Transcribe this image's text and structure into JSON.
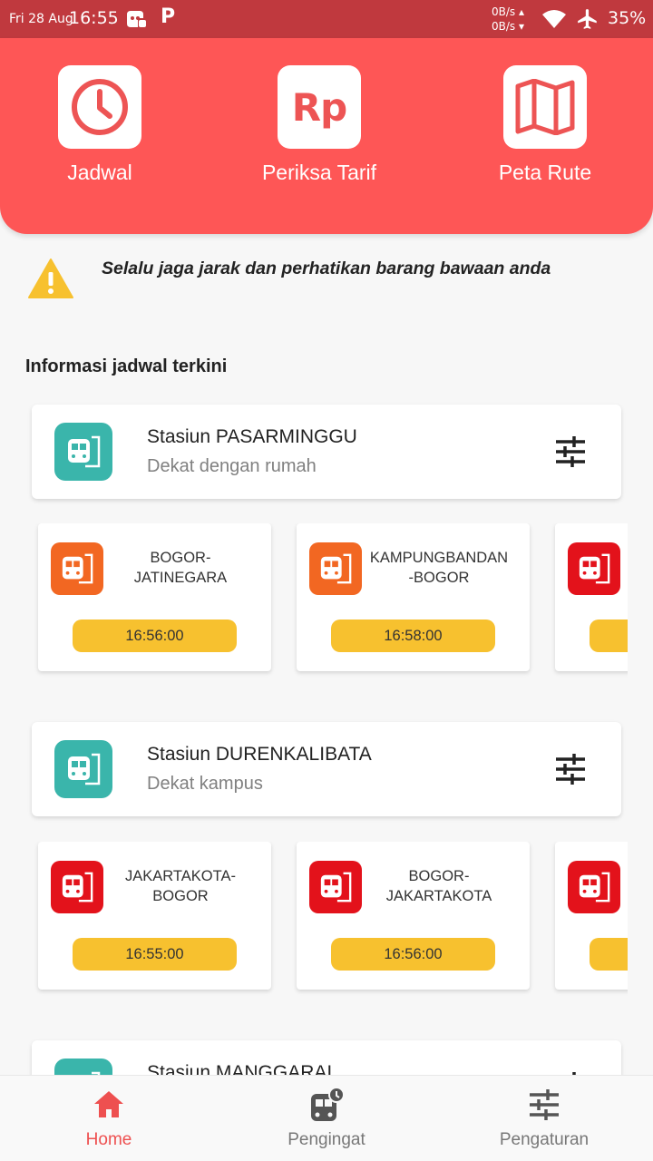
{
  "status_bar": {
    "date": "Fri 28 Aug",
    "time": "16:55",
    "net_up": "0B/s ▴",
    "net_down": "0B/s ▾",
    "battery": "35%"
  },
  "header": {
    "buttons": [
      {
        "label": "Jadwal",
        "icon": "clock-icon"
      },
      {
        "label": "Periksa Tarif",
        "icon": "rp-icon",
        "icon_text": "Rp"
      },
      {
        "label": "Peta Rute",
        "icon": "map-icon"
      }
    ]
  },
  "warning": {
    "text": "Selalu jaga jarak dan perhatikan barang bawaan anda"
  },
  "section_title": "Informasi jadwal terkini",
  "stations": [
    {
      "name": "Stasiun PASARMINGGU",
      "subtitle": "Dekat dengan rumah",
      "trains": [
        {
          "route": "BOGOR-\nJATINEGARA",
          "time": "16:56:00",
          "color": "#f26722"
        },
        {
          "route": "KAMPUNGBANDAN\n-BOGOR",
          "time": "16:58:00",
          "color": "#f26722"
        },
        {
          "route": "",
          "time": "",
          "color": "#e3121b"
        }
      ]
    },
    {
      "name": "Stasiun DURENKALIBATA",
      "subtitle": "Dekat kampus",
      "trains": [
        {
          "route": "JAKARTAKOTA-\nBOGOR",
          "time": "16:55:00",
          "color": "#e3121b"
        },
        {
          "route": "BOGOR-\nJAKARTAKOTA",
          "time": "16:56:00",
          "color": "#e3121b"
        },
        {
          "route": "",
          "time": "",
          "color": "#e3121b"
        }
      ]
    },
    {
      "name": "Stasiun MANGGARAI",
      "subtitle": "",
      "trains": []
    }
  ],
  "colors": {
    "header": "#fe5656",
    "station_icon": "#3ab5ab",
    "time_pill": "#f7c12f",
    "active_nav": "#ee5050"
  },
  "bottom_nav": [
    {
      "label": "Home",
      "icon": "home-icon",
      "active": true
    },
    {
      "label": "Pengingat",
      "icon": "reminder-icon",
      "active": false
    },
    {
      "label": "Pengaturan",
      "icon": "settings-icon",
      "active": false
    }
  ]
}
